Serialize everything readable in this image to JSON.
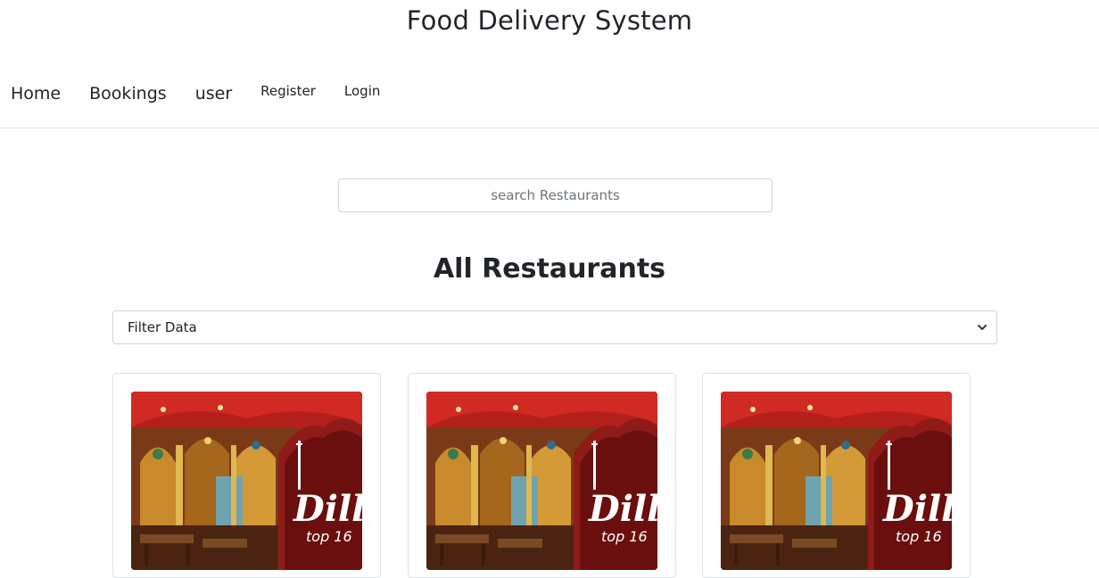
{
  "header": {
    "title": "Food Delivery System"
  },
  "nav": {
    "items": [
      {
        "label": "Home"
      },
      {
        "label": "Bookings"
      },
      {
        "label": "user"
      },
      {
        "label": "Register"
      },
      {
        "label": "Login"
      }
    ]
  },
  "search": {
    "placeholder": "search Restaurants",
    "value": ""
  },
  "restaurants": {
    "heading": "All Restaurants",
    "filter": {
      "selected": "Filter Data",
      "icon": "chevron-down-icon"
    },
    "cards": [
      {
        "image_alt": "Dilli top 16 restaurant",
        "logo_text": "Dilli",
        "logo_sub": "top 16"
      },
      {
        "image_alt": "Dilli top 16 restaurant",
        "logo_text": "Dilli",
        "logo_sub": "top 16"
      },
      {
        "image_alt": "Dilli top 16 restaurant",
        "logo_text": "Dilli",
        "logo_sub": "top 16"
      }
    ]
  },
  "colors": {
    "text": "#212529",
    "border": "#ced4da",
    "card_border": "#dee2e6",
    "image_red": "#8e1b17"
  }
}
